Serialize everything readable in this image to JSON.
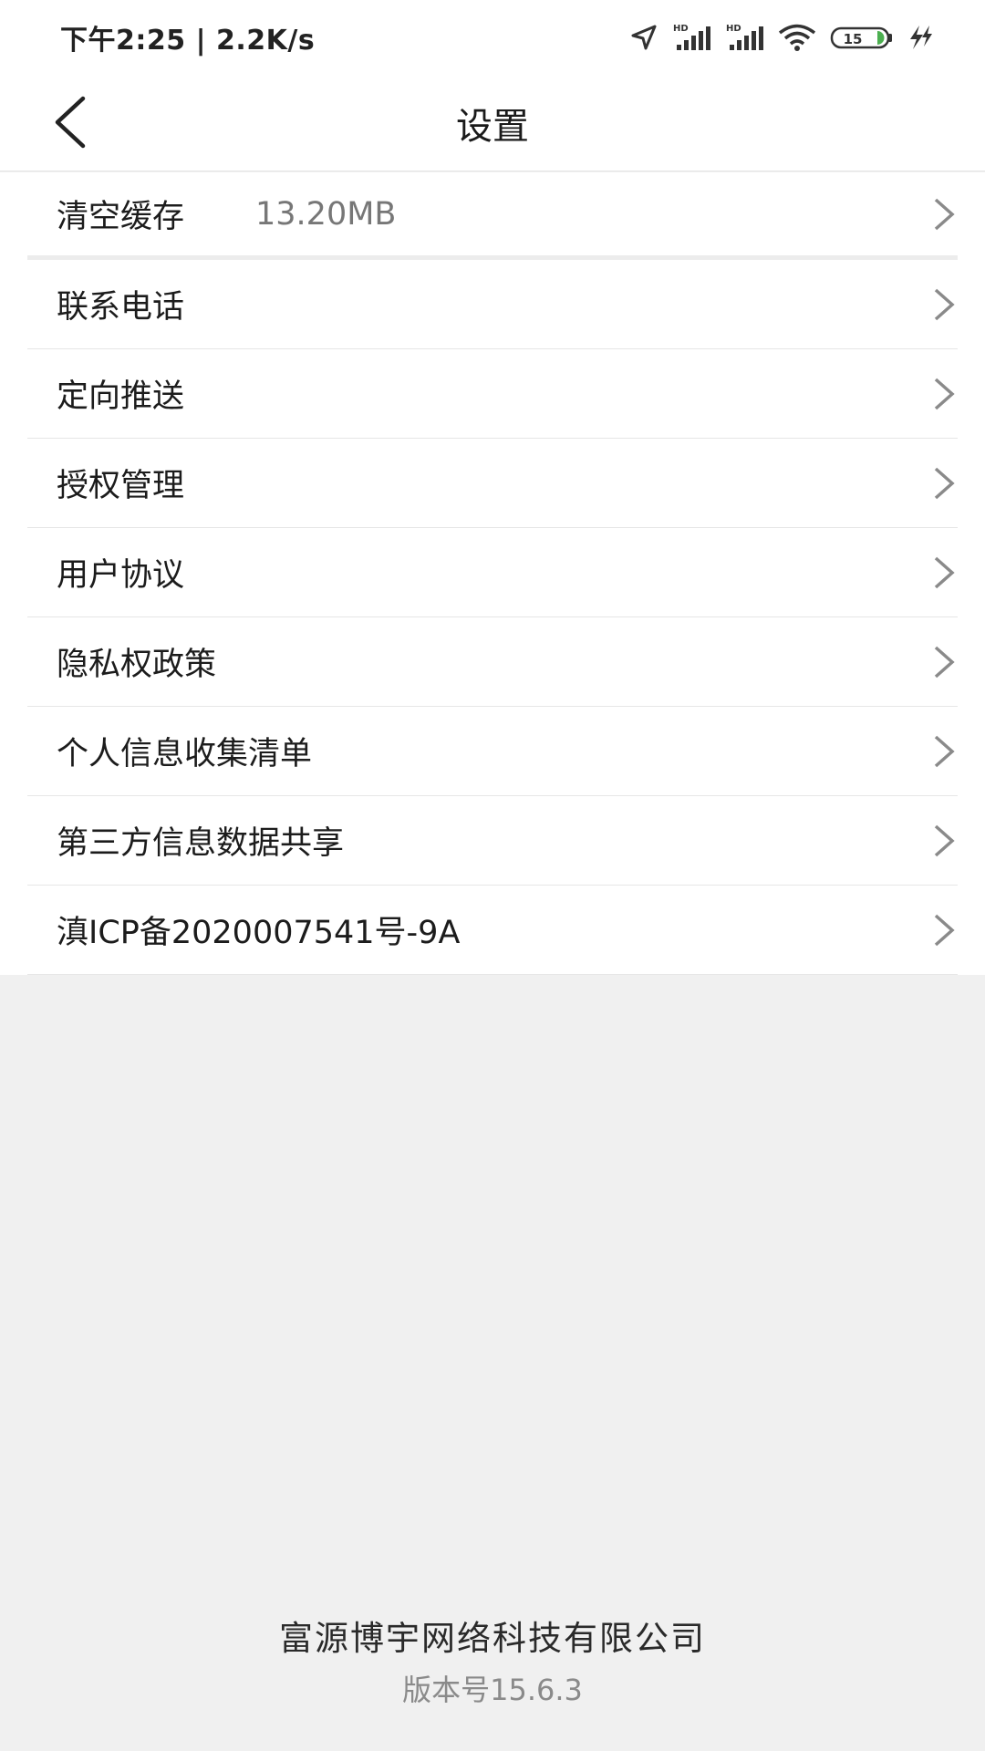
{
  "status_bar": {
    "time_speed": "下午2:25 | 2.2K/s",
    "sim1_tag": "HD",
    "sim2_tag": "HD",
    "battery_level": "15",
    "icons": [
      "location-arrow-icon",
      "signal-icon",
      "signal-icon",
      "wifi-icon",
      "battery-icon",
      "charging-icon"
    ],
    "battery_color": "#4caf50"
  },
  "header": {
    "title": "设置",
    "back_icon": "chevron-left-icon"
  },
  "settings": {
    "items": [
      {
        "label": "清空缓存",
        "value": "13.20MB"
      },
      {
        "label": "联系电话"
      },
      {
        "label": "定向推送"
      },
      {
        "label": "授权管理"
      },
      {
        "label": "用户协议"
      },
      {
        "label": "隐私权政策"
      },
      {
        "label": "个人信息收集清单"
      },
      {
        "label": "第三方信息数据共享"
      },
      {
        "label": "滇ICP备2020007541号-9A"
      }
    ]
  },
  "footer": {
    "company": "富源博宇网络科技有限公司",
    "version": "版本号15.6.3"
  }
}
